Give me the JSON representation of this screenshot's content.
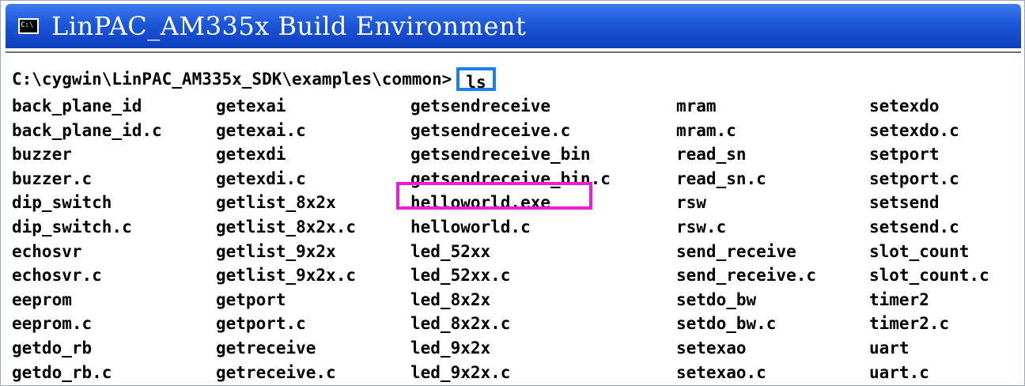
{
  "window": {
    "title": "LinPAC_AM335x Build Environment",
    "icon": "cmd-icon"
  },
  "console": {
    "prompt": "C:\\cygwin\\LinPAC_AM335x_SDK\\examples\\common>",
    "command": "ls",
    "command_highlight_color": "#1a7fe6",
    "file_highlight_color": "#e81fd6",
    "highlighted_file": "helloworld.exe",
    "rows": [
      [
        "back_plane_id",
        "getexai",
        "getsendreceive",
        "mram",
        "setexdo"
      ],
      [
        "back_plane_id.c",
        "getexai.c",
        "getsendreceive.c",
        "mram.c",
        "setexdo.c"
      ],
      [
        "buzzer",
        "getexdi",
        "getsendreceive_bin",
        "read_sn",
        "setport"
      ],
      [
        "buzzer.c",
        "getexdi.c",
        "getsendreceive_bin.c",
        "read_sn.c",
        "setport.c"
      ],
      [
        "dip_switch",
        "getlist_8x2x",
        "helloworld.exe",
        "rsw",
        "setsend"
      ],
      [
        "dip_switch.c",
        "getlist_8x2x.c",
        "helloworld.c",
        "rsw.c",
        "setsend.c"
      ],
      [
        "echosvr",
        "getlist_9x2x",
        "led_52xx",
        "send_receive",
        "slot_count"
      ],
      [
        "echosvr.c",
        "getlist_9x2x.c",
        "led_52xx.c",
        "send_receive.c",
        "slot_count.c"
      ],
      [
        "eeprom",
        "getport",
        "led_8x2x",
        "setdo_bw",
        "timer2"
      ],
      [
        "eeprom.c",
        "getport.c",
        "led_8x2x.c",
        "setdo_bw.c",
        "timer2.c"
      ],
      [
        "getdo_rb",
        "getreceive",
        "led_9x2x",
        "setexao",
        "uart"
      ],
      [
        "getdo_rb.c",
        "getreceive.c",
        "led_9x2x.c",
        "setexao.c",
        "uart.c"
      ]
    ]
  }
}
